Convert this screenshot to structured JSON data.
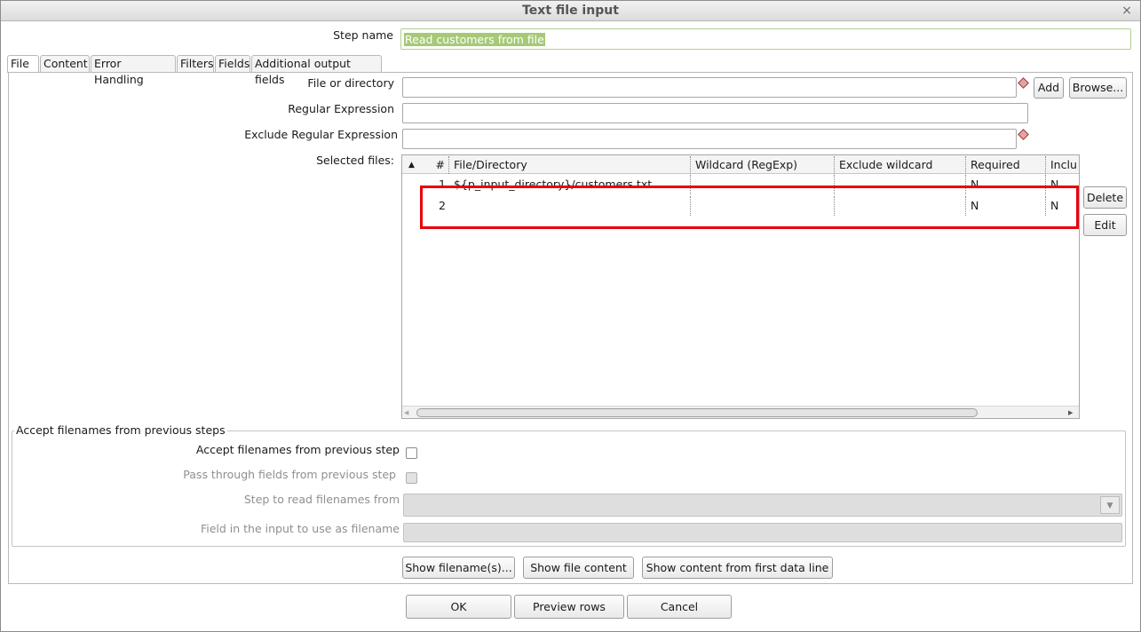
{
  "window": {
    "title": "Text file input",
    "close_glyph": "×"
  },
  "step_name": {
    "label": "Step name",
    "value": "Read customers from file"
  },
  "tabs": [
    {
      "label": "File",
      "active": true
    },
    {
      "label": "Content"
    },
    {
      "label": "Error Handling"
    },
    {
      "label": "Filters"
    },
    {
      "label": "Fields"
    },
    {
      "label": "Additional output fields"
    }
  ],
  "file_tab": {
    "file_or_directory_label": "File or directory",
    "file_or_directory_value": "",
    "add_label": "Add",
    "browse_label": "Browse...",
    "regex_label": "Regular Expression",
    "regex_value": "",
    "exclude_regex_label": "Exclude Regular Expression",
    "exclude_regex_value": "",
    "selected_files_label": "Selected files:",
    "delete_label": "Delete",
    "edit_label": "Edit",
    "table": {
      "sort_glyph": "▲",
      "columns": [
        "#",
        "File/Directory",
        "Wildcard (RegExp)",
        "Exclude wildcard",
        "Required",
        "Inclu"
      ],
      "rows": [
        {
          "num": "1",
          "file": "${p_input_directory}/customers.txt",
          "wildcard": "",
          "exclude": "",
          "required": "N",
          "include": "N"
        },
        {
          "num": "2",
          "file": "",
          "wildcard": "",
          "exclude": "",
          "required": "N",
          "include": "N"
        }
      ]
    },
    "scroll": {
      "left_glyph": "◀",
      "right_glyph": "▶"
    }
  },
  "accept_group": {
    "title": "Accept filenames from previous steps",
    "accept_label": "Accept filenames from previous step",
    "pass_through_label": "Pass through fields from previous step",
    "step_label": "Step to read filenames from",
    "field_label": "Field in the input to use as filename",
    "dropdown_glyph": "▼"
  },
  "bottom_buttons": {
    "show_filenames": "Show filename(s)...",
    "show_file_content": "Show file content",
    "show_first_line": "Show content from first data line"
  },
  "dialog_buttons": {
    "ok": "OK",
    "preview": "Preview rows",
    "cancel": "Cancel"
  },
  "colors": {
    "highlight_box": "#e8000b",
    "step_name_selection": "#a6c977"
  }
}
